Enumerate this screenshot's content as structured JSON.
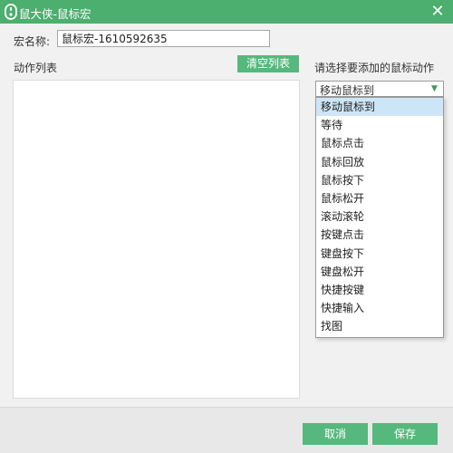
{
  "window": {
    "title": "鼠大侠-鼠标宏",
    "close_glyph": "✕",
    "accent_color": "#4cae6f"
  },
  "macro": {
    "name_label": "宏名称:",
    "name_value": "鼠标宏-1610592635"
  },
  "actions": {
    "label": "动作列表",
    "clear_button": "清空列表"
  },
  "picker": {
    "prompt": "请选择要添加的鼠标动作",
    "selected_value": "移动鼠标到",
    "arrow_glyph": "▼",
    "options": [
      "移动鼠标到",
      "等待",
      "鼠标点击",
      "鼠标回放",
      "鼠标按下",
      "鼠标松开",
      "滚动滚轮",
      "按键点击",
      "键盘按下",
      "键盘松开",
      "快捷按键",
      "快捷输入",
      "找图"
    ],
    "highlighted_index": 0,
    "highlight_color": "#cde6f7"
  },
  "footer": {
    "cancel_button": "取消",
    "save_button": "保存"
  }
}
